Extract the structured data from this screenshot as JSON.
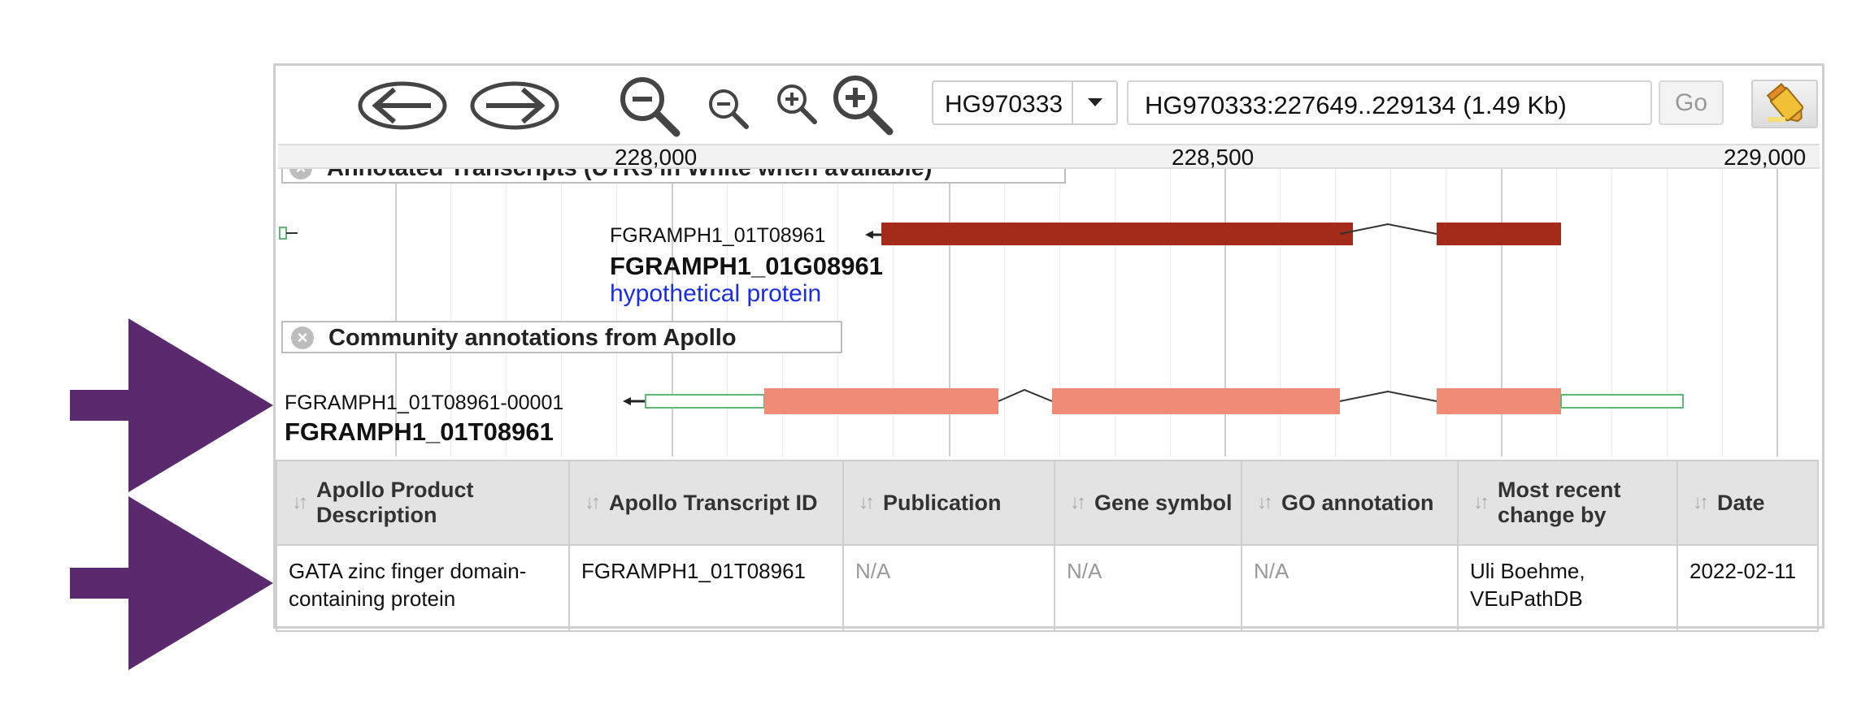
{
  "toolbar": {
    "back_icon": "arrow-left-icon",
    "forward_icon": "arrow-right-icon",
    "reference_sequence": "HG970333",
    "location": "HG970333:227649..229134 (1.49 Kb)",
    "go_label": "Go",
    "highlight_icon": "highlighter-icon"
  },
  "ruler": {
    "labels": [
      "228,000",
      "228,500",
      "229,000"
    ]
  },
  "tracks": {
    "annotated": {
      "label": "Annotated Transcripts (UTRs in White when available)",
      "transcript_id": "FGRAMPH1_01T08961",
      "gene_id": "FGRAMPH1_01G08961",
      "description": "hypothetical protein",
      "exon_color": "#a42a1a"
    },
    "apollo": {
      "label": "Community annotations from Apollo",
      "transcript_id": "FGRAMPH1_01T08961-00001",
      "name": "FGRAMPH1_01T08961",
      "exon_color": "#f08c76",
      "utr_color": "#5fb878"
    }
  },
  "table": {
    "headers": [
      "Apollo Product Description",
      "Apollo Transcript ID",
      "Publication",
      "Gene symbol",
      "GO annotation",
      "Most recent change by",
      "Date"
    ],
    "rows": [
      {
        "description": "GATA zinc finger domain-containing protein",
        "transcript_id": "FGRAMPH1_01T08961",
        "publication": "N/A",
        "gene_symbol": "N/A",
        "go_annotation": "N/A",
        "changed_by": "Uli Boehme, VEuPathDB",
        "date": "2022-02-11"
      }
    ]
  },
  "arrow_color": "#5b2a6e"
}
